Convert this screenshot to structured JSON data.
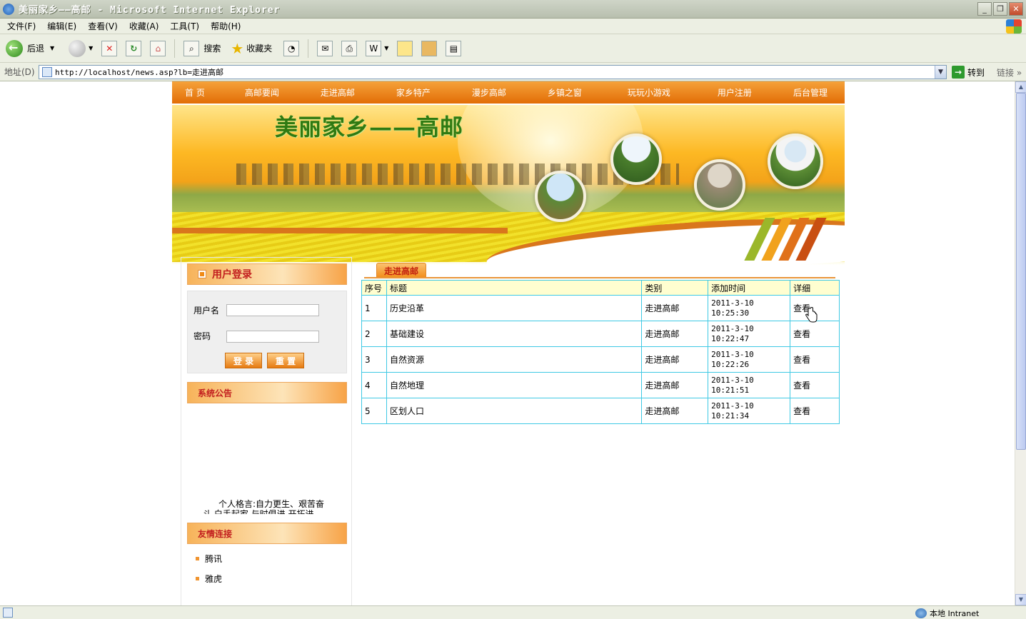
{
  "window": {
    "title": "美丽家乡——高邮 - Microsoft Internet Explorer",
    "controls": {
      "minimize": "_",
      "restore": "❐",
      "close": "✕"
    }
  },
  "menubar": {
    "items": [
      {
        "label": "文件(F)"
      },
      {
        "label": "编辑(E)"
      },
      {
        "label": "查看(V)"
      },
      {
        "label": "收藏(A)"
      },
      {
        "label": "工具(T)"
      },
      {
        "label": "帮助(H)"
      }
    ]
  },
  "toolbar": {
    "back_label": "后退",
    "search_label": "搜索",
    "favorites_label": "收藏夹"
  },
  "addressbar": {
    "label": "地址(D)",
    "url": "http://localhost/news.asp?lb=走进高邮",
    "go_label": "转到",
    "links_label": "链接 »"
  },
  "status": {
    "zone": "本地 Intranet"
  },
  "site": {
    "nav": [
      {
        "label": "首 页"
      },
      {
        "label": "高邮要闻"
      },
      {
        "label": "走进高邮"
      },
      {
        "label": "家乡特产"
      },
      {
        "label": "漫步高邮"
      },
      {
        "label": "乡镇之窗"
      },
      {
        "label": "玩玩小游戏"
      },
      {
        "label": "用户注册"
      },
      {
        "label": "后台管理"
      }
    ],
    "banner_title": "美丽家乡——高邮",
    "login": {
      "title": "用户登录",
      "username_label": "用户名",
      "password_label": "密码",
      "username_value": "",
      "password_value": "",
      "login_button": "登 录",
      "reset_button": "重 置"
    },
    "notice": {
      "title": "系统公告",
      "line1": "个人格言:自力更生、艰苦奋",
      "line2": "斗,白手起家,与时俱进,开拓进"
    },
    "friend_links": {
      "title": "友情连接",
      "items": [
        {
          "label": "腾讯"
        },
        {
          "label": "雅虎"
        }
      ]
    },
    "content_tab": "走进高邮",
    "table": {
      "headers": [
        "序号",
        "标题",
        "类别",
        "添加时间",
        "详细"
      ],
      "rows": [
        {
          "no": "1",
          "title": "历史沿革",
          "category": "走进高邮",
          "date": "2011-3-10",
          "time": "10:25:30",
          "detail": "查看"
        },
        {
          "no": "2",
          "title": "基础建设",
          "category": "走进高邮",
          "date": "2011-3-10",
          "time": "10:22:47",
          "detail": "查看"
        },
        {
          "no": "3",
          "title": "自然资源",
          "category": "走进高邮",
          "date": "2011-3-10",
          "time": "10:22:26",
          "detail": "查看"
        },
        {
          "no": "4",
          "title": "自然地理",
          "category": "走进高邮",
          "date": "2011-3-10",
          "time": "10:21:51",
          "detail": "查看"
        },
        {
          "no": "5",
          "title": "区划人口",
          "category": "走进高邮",
          "date": "2011-3-10",
          "time": "10:21:34",
          "detail": "查看"
        }
      ]
    }
  }
}
